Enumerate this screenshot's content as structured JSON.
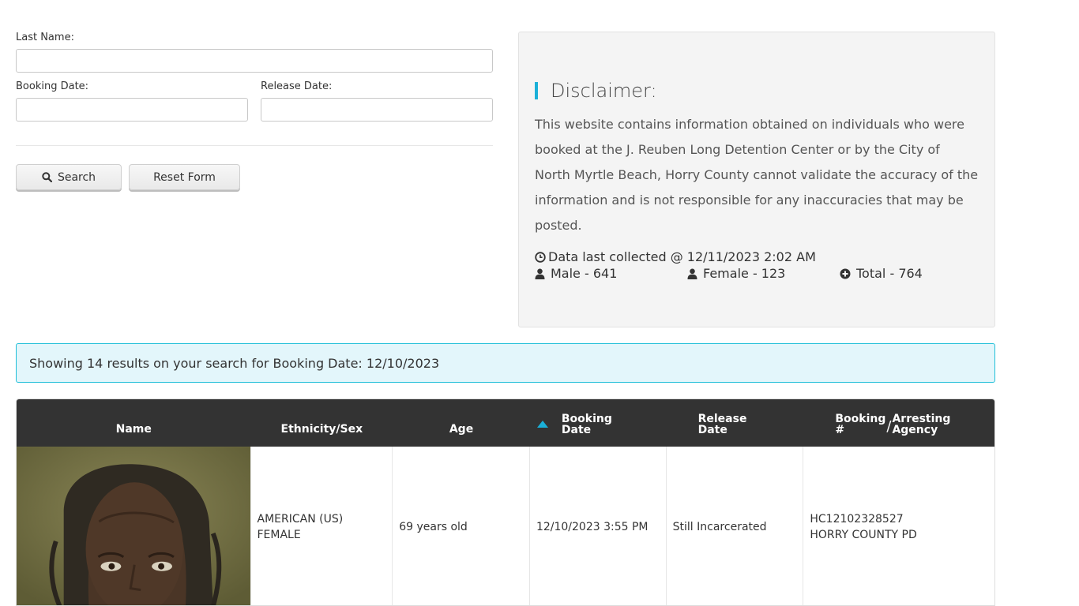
{
  "search_form": {
    "last_name_label": "Last Name:",
    "last_name_value": "",
    "booking_date_label": "Booking Date:",
    "booking_date_value": "",
    "release_date_label": "Release Date:",
    "release_date_value": "",
    "search_button": "Search",
    "reset_button": "Reset Form"
  },
  "disclaimer": {
    "title": "Disclaimer:",
    "text": "This website contains information obtained on individuals who were booked at the J. Reuben Long Detention Center or by the City of North Myrtle Beach, Horry County cannot validate the accuracy of the information and is not responsible for any inaccuracies that may be posted.",
    "collected": "Data last collected @ 12/11/2023 2:02 AM",
    "male": "Male - 641",
    "female": "Female - 123",
    "total": "Total - 764"
  },
  "results_banner": "Showing 14 results on your search for Booking Date: 12/10/2023",
  "table": {
    "headers": {
      "name": "Name",
      "ethnicity_sex": "Ethnicity/Sex",
      "age": "Age",
      "booking_date_1": "Booking",
      "booking_date_2": "Date",
      "release_date_1": "Release",
      "release_date_2": "Date",
      "booking_no_1": "Booking",
      "booking_no_2": "#",
      "arresting_1": "Arresting",
      "arresting_2": "Agency"
    },
    "rows": [
      {
        "ethnicity": "AMERICAN (US)",
        "sex": "FEMALE",
        "age": "69 years old",
        "booking_date": "12/10/2023 3:55 PM",
        "release_date": "Still Incarcerated",
        "booking_number": "HC12102328527",
        "agency": "HORRY COUNTY PD"
      }
    ]
  },
  "colors": {
    "accent": "#1ab0d8",
    "header_bg": "#333333",
    "banner_bg": "#e3f6fb"
  },
  "icons": [
    "search-icon",
    "clock-icon",
    "user-icon",
    "plus-circle-icon",
    "sort-asc-icon"
  ]
}
